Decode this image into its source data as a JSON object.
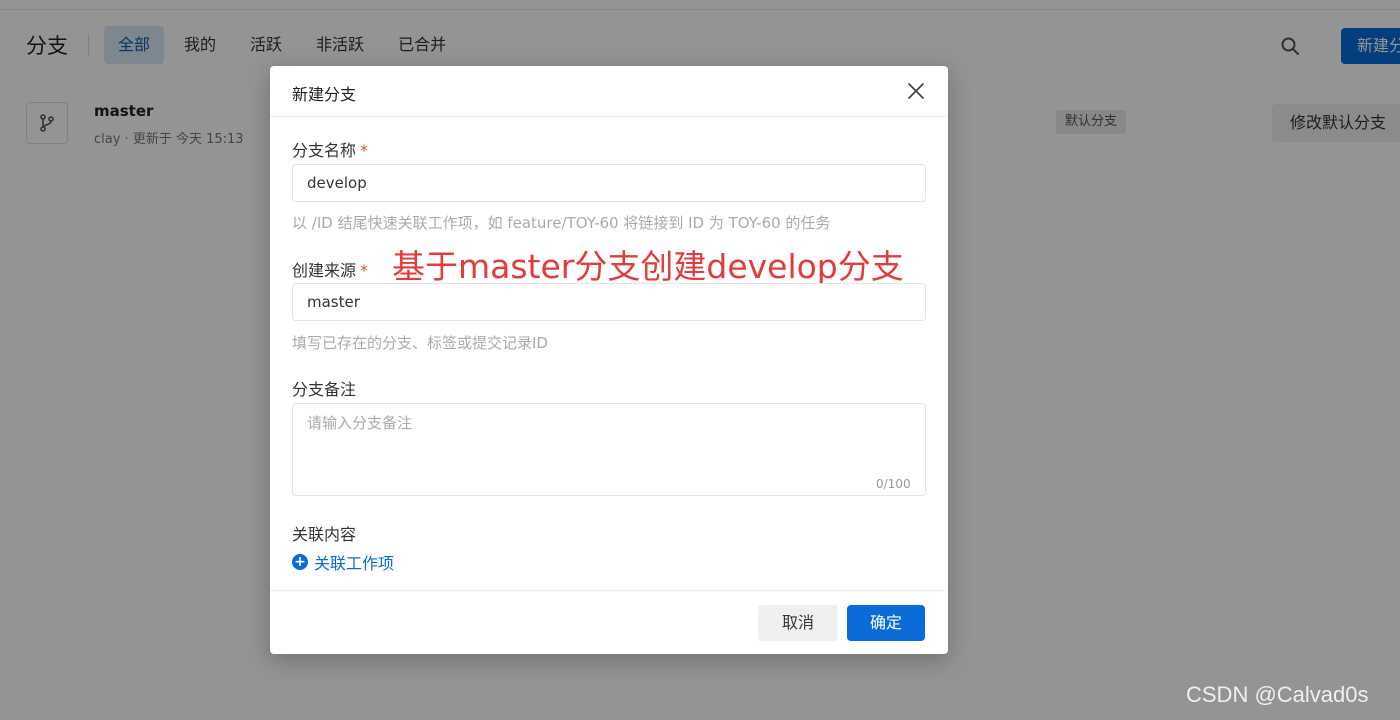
{
  "header": {
    "title": "分支",
    "tabs": [
      {
        "label": "全部",
        "active": true
      },
      {
        "label": "我的",
        "active": false
      },
      {
        "label": "活跃",
        "active": false
      },
      {
        "label": "非活跃",
        "active": false
      },
      {
        "label": "已合并",
        "active": false
      }
    ],
    "new_button_label": "新建分"
  },
  "branch": {
    "name": "master",
    "meta": "clay · 更新于 今天 15:13",
    "badge": "默认分支",
    "change_default_label": "修改默认分支"
  },
  "modal": {
    "title": "新建分支",
    "name_field": {
      "label": "分支名称",
      "required_mark": "*",
      "value": "develop",
      "hint": "以 /ID 结尾快速关联工作项，如 feature/TOY-60 将链接到 ID 为 TOY-60 的任务"
    },
    "source_field": {
      "label": "创建来源",
      "required_mark": "*",
      "value": "master",
      "hint": "填写已存在的分支、标签或提交记录ID"
    },
    "note_field": {
      "label": "分支备注",
      "placeholder": "请输入分支备注",
      "counter": "0/100"
    },
    "related": {
      "label": "关联内容",
      "link_label": "关联工作项",
      "plus_glyph": "+"
    },
    "footer": {
      "cancel_label": "取消",
      "ok_label": "确定"
    }
  },
  "annotation": "基于master分支创建develop分支",
  "watermark": "CSDN @Calvad0s",
  "colors": {
    "primary": "#0a6bd6",
    "annotation": "#e33b3b",
    "required": "#e5484d"
  }
}
